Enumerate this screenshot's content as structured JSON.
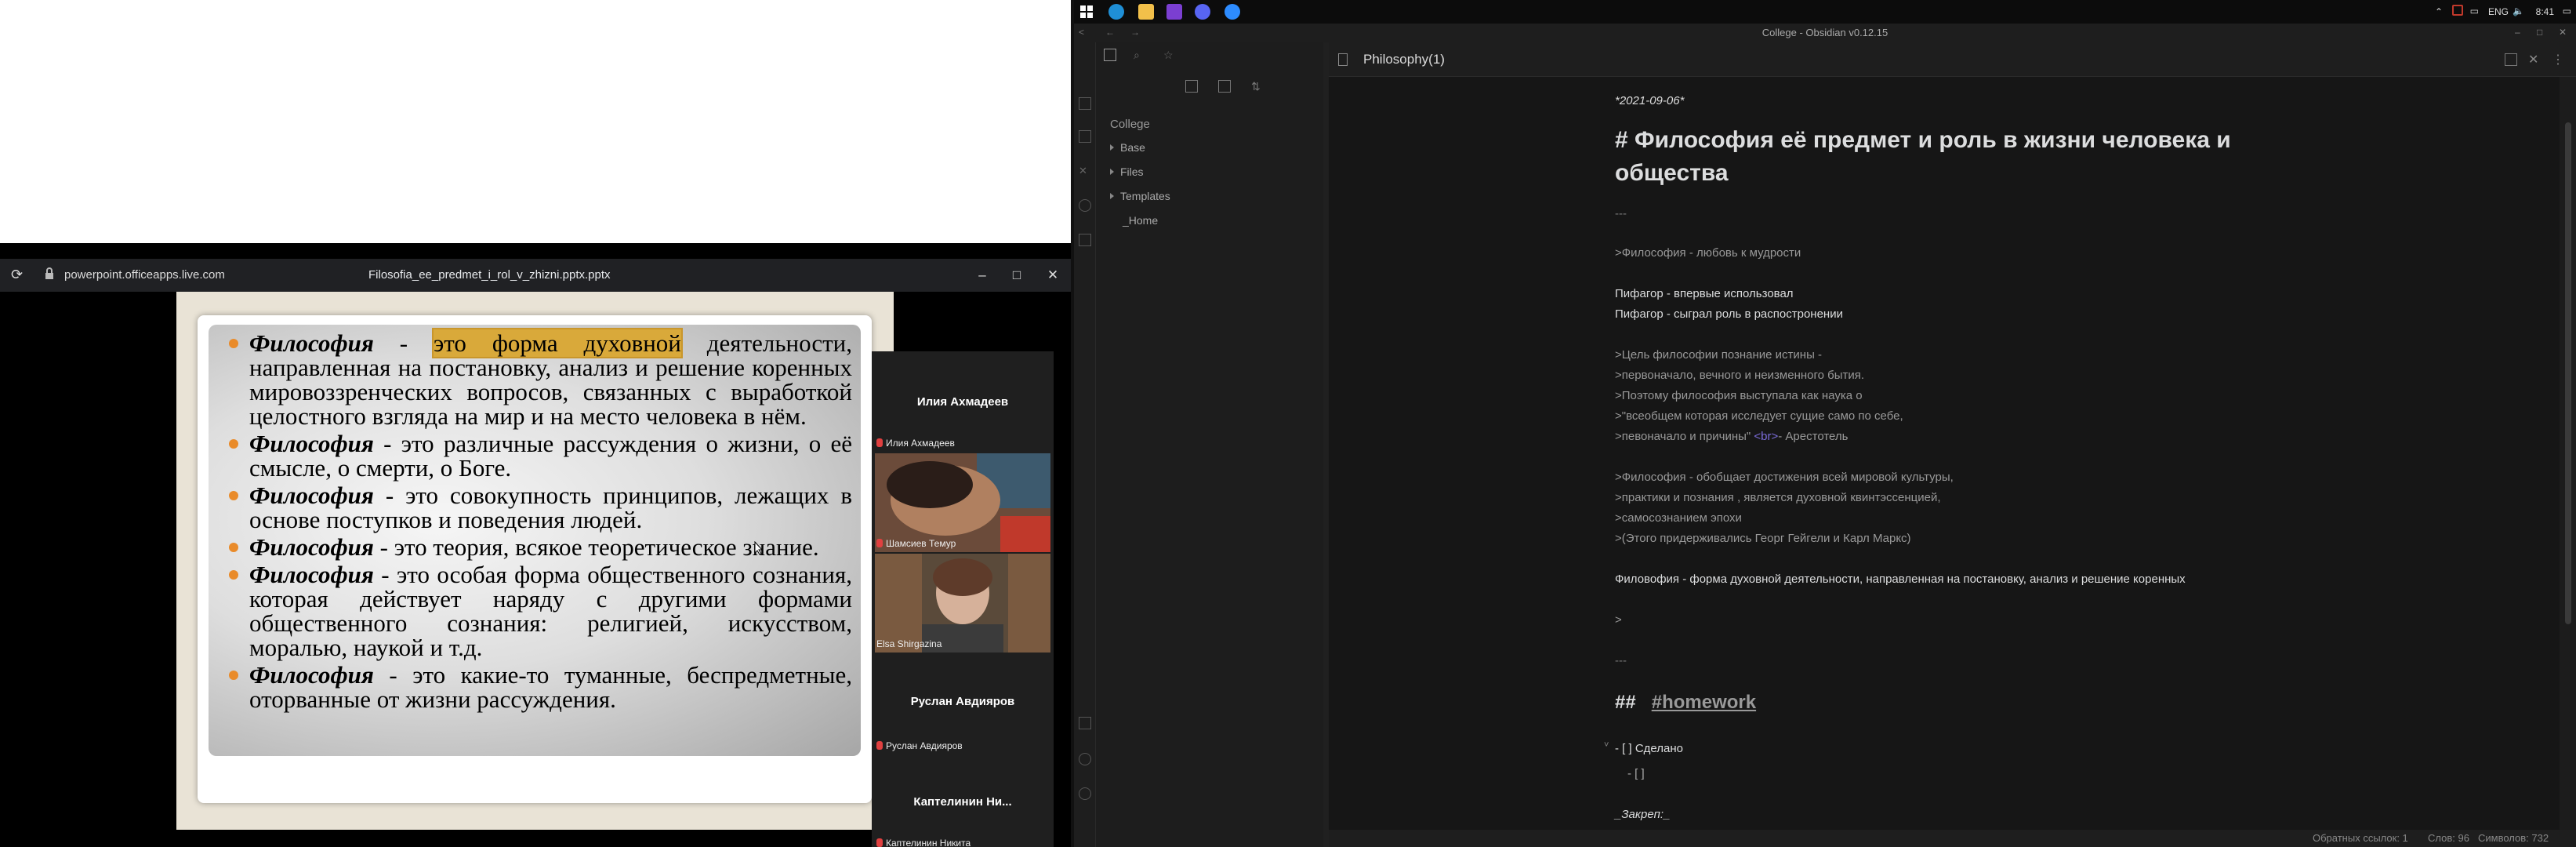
{
  "browser": {
    "url": "powerpoint.officeapps.live.com",
    "document_title": "Filosofia_ee_predmet_i_rol_v_zhizni.pptx.pptx",
    "minimize": "–",
    "maximize": "□",
    "close": "✕"
  },
  "slide": {
    "bullets": [
      {
        "term": "Философия",
        "highlight": "это форма духовной",
        "rest": " - ",
        "text": " деятельности, направленная на постановку, анализ и решение коренных мировоззренческих вопросов, связанных с выработкой целостного взгляда на мир и на место человека в нём."
      },
      {
        "term": "Философия",
        "text": " - это различные рассуждения о жизни, о её смысле, о смерти, о Боге."
      },
      {
        "term": "Философия",
        "text": " - это совокупность принципов, лежащих в основе поступков и поведения людей."
      },
      {
        "term": "Философия",
        "text": " - это теория, всякое теоретическое знание."
      },
      {
        "term": "Философия",
        "text": " - это особая форма общественного сознания, которая действует наряду с другими формами общественного сознания: религией, искусством, моралью, наукой и т.д."
      },
      {
        "term": "Философия",
        "text": " - это какие-то туманные, беспредметные, оторванные от жизни рассуждения."
      }
    ]
  },
  "video": {
    "tiles": [
      {
        "name": "Илия Ахмадеев",
        "tag": "Илия Ахмадеев"
      },
      {
        "tag": "Шамсиев Темур"
      },
      {
        "tag": "Elsa Shirgazina"
      },
      {
        "name": "Руслан Авдияров",
        "tag": "Руслан Авдияров"
      },
      {
        "name": "Каптелинин Ни...",
        "tag": "Каптелинин Никита"
      }
    ]
  },
  "taskbar": {
    "lang": "ENG",
    "time": "8:41"
  },
  "obsidian": {
    "window_title": "College - Obsidian v0.12.15",
    "tab_title": "Philosophy(1)",
    "vault": "College",
    "folders": [
      "Base",
      "Files",
      "Templates"
    ],
    "files": [
      "_Home"
    ],
    "lines": {
      "date": "*2021-09-06*",
      "h1": "# Философия её предмет и роль в жизни человека и общества",
      "hr1": "---",
      "q1": ">Философия - любовь к мудрости",
      "p1": "Пифагор - впервые использовал",
      "p2": "Пифагор - сыграл роль в распостронении",
      "q2": ">Цель философии познание истины -",
      "q3": ">первоначало, вечного и неизменного бытия.",
      "q4": ">Поэтому философия выступала как наука о",
      "q5": ">\"всеобщем которая исследует сущие само по себе,",
      "q6a": ">певоначало и причины\" ",
      "q6b": "<br>",
      "q6c": "- Арестотель",
      "q7": ">Философия - обобщает достижения всей мировой культуры,",
      "q8": ">практики и познания , является духовной квинтэссенцией,",
      "q9": ">самосознанием эпохи",
      "q10": ">(Этого придерживались Георг Гейгели и Карл Маркс)",
      "p3": "Филовофия - форма духовной деятельности, направленная на постановку, анализ и решение коренных",
      "gt": ">",
      "hr2": "---",
      "h2_hash": "##",
      "h2_tag": "#homework",
      "task1": "- [ ] Сделано",
      "task2": "- [ ]",
      "closing": "_Закреп:_"
    },
    "status": {
      "backlinks": "Обратных ссылок: 1",
      "words": "Слов: 96",
      "chars": "Символов: 732"
    }
  }
}
